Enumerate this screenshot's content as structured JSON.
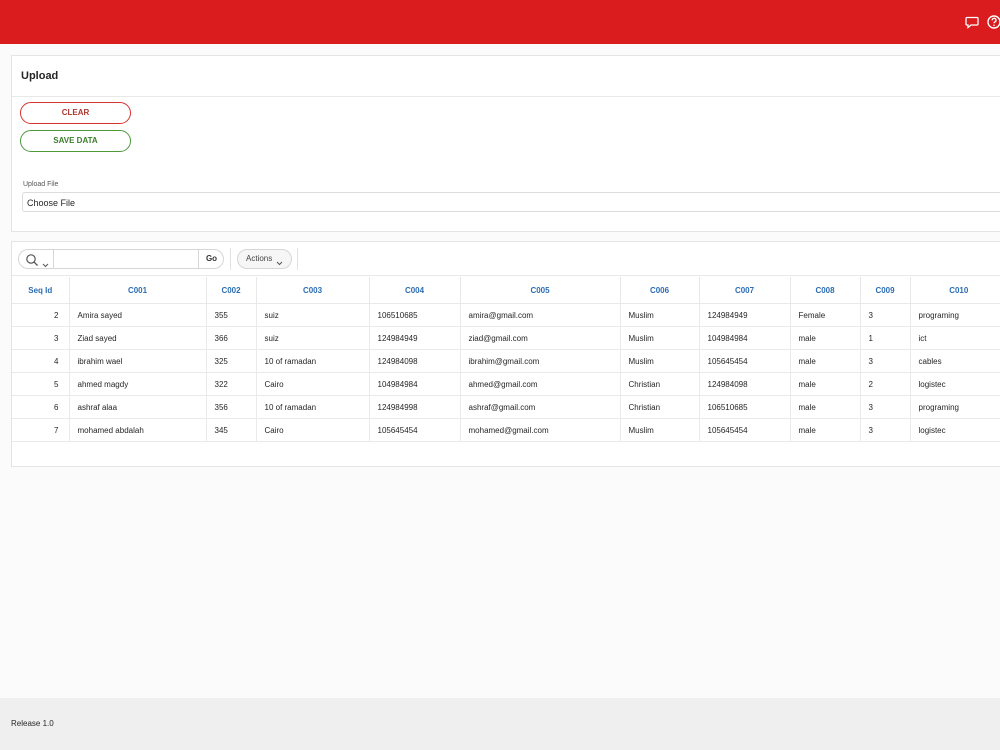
{
  "upload": {
    "title": "Upload",
    "clear_label": "CLEAR",
    "save_label": "SAVE DATA",
    "file_label": "Upload File",
    "file_button": "Choose File"
  },
  "report": {
    "go_label": "Go",
    "actions_label": "Actions",
    "columns": [
      "Seq Id",
      "C001",
      "C002",
      "C003",
      "C004",
      "C005",
      "C006",
      "C007",
      "C008",
      "C009",
      "C010"
    ],
    "rows": [
      [
        "2",
        "Amira sayed",
        "355",
        "suiz",
        "106510685",
        "amira@gmail.com",
        "Muslim",
        "124984949",
        "Female",
        "3",
        "programing"
      ],
      [
        "3",
        "Ziad sayed",
        "366",
        "suiz",
        "124984949",
        "ziad@gmail.com",
        "Muslim",
        "104984984",
        "male",
        "1",
        "ict"
      ],
      [
        "4",
        "ibrahim wael",
        "325",
        "10 of ramadan",
        "124984098",
        "ibrahim@gmail.com",
        "Muslim",
        "105645454",
        "male",
        "3",
        "cables"
      ],
      [
        "5",
        "ahmed magdy",
        "322",
        "Cairo",
        "104984984",
        "ahmed@gmail.com",
        "Christian",
        "124984098",
        "male",
        "2",
        "logistec"
      ],
      [
        "6",
        "ashraf alaa",
        "356",
        "10 of ramadan",
        "124984998",
        "ashraf@gmail.com",
        "Christian",
        "106510685",
        "male",
        "3",
        "programing"
      ],
      [
        "7",
        "mohamed abdalah",
        "345",
        "Cairo",
        "105645454",
        "mohamed@gmail.com",
        "Muslim",
        "105645454",
        "male",
        "3",
        "logistec"
      ]
    ]
  },
  "footer": {
    "release": "Release 1.0"
  },
  "icons": {
    "topbar": [
      "chat-icon",
      "help-icon"
    ]
  },
  "colors": {
    "header": "#da1c1f",
    "column_header": "#2c6db5",
    "clear_border": "#d8322f",
    "save_border": "#4c9a3a"
  }
}
